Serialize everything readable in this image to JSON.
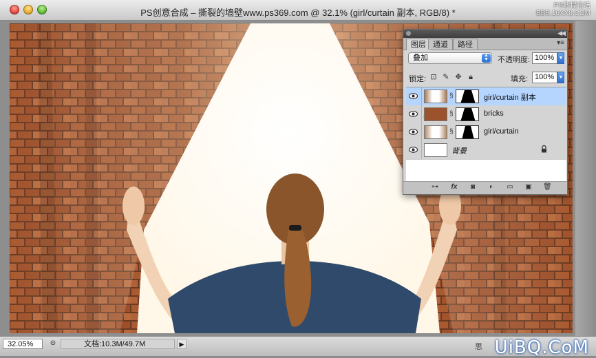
{
  "window": {
    "title": "PS创意合成 – 撕裂的墙壁www.ps369.com @ 32.1% (girl/curtain 副本, RGB/8) *"
  },
  "watermark_top": {
    "line1": "PS教程论坛",
    "line2": "BBS.16XX8.COM"
  },
  "watermark_bottom": {
    "text": "UiBQ.CoM",
    "small": "思"
  },
  "panel": {
    "tabs": [
      {
        "label": "图层",
        "active": true
      },
      {
        "label": "通道",
        "active": false
      },
      {
        "label": "路径",
        "active": false
      }
    ],
    "blend_mode": "叠加",
    "opacity_label": "不透明度:",
    "opacity_value": "100%",
    "lock_label": "锁定:",
    "fill_label": "填充:",
    "fill_value": "100%",
    "layers": [
      {
        "name": "girl/curtain 副本",
        "selected": true,
        "visible": true
      },
      {
        "name": "bricks",
        "selected": false,
        "visible": true
      },
      {
        "name": "girl/curtain",
        "selected": false,
        "visible": true
      },
      {
        "name": "背景",
        "selected": false,
        "visible": true,
        "locked": true
      }
    ],
    "footer_icons": [
      "link-icon",
      "fx-icon",
      "mask-icon",
      "adjustment-icon",
      "group-icon",
      "new-layer-icon",
      "trash-icon"
    ]
  },
  "status": {
    "zoom": "32.05%",
    "doc_info": "文档:10.3M/49.7M"
  },
  "colors": {
    "selection": "#b5d5ff",
    "brick": "#a5532b",
    "sweater": "#2f4a6b",
    "hair": "#8a552a"
  }
}
